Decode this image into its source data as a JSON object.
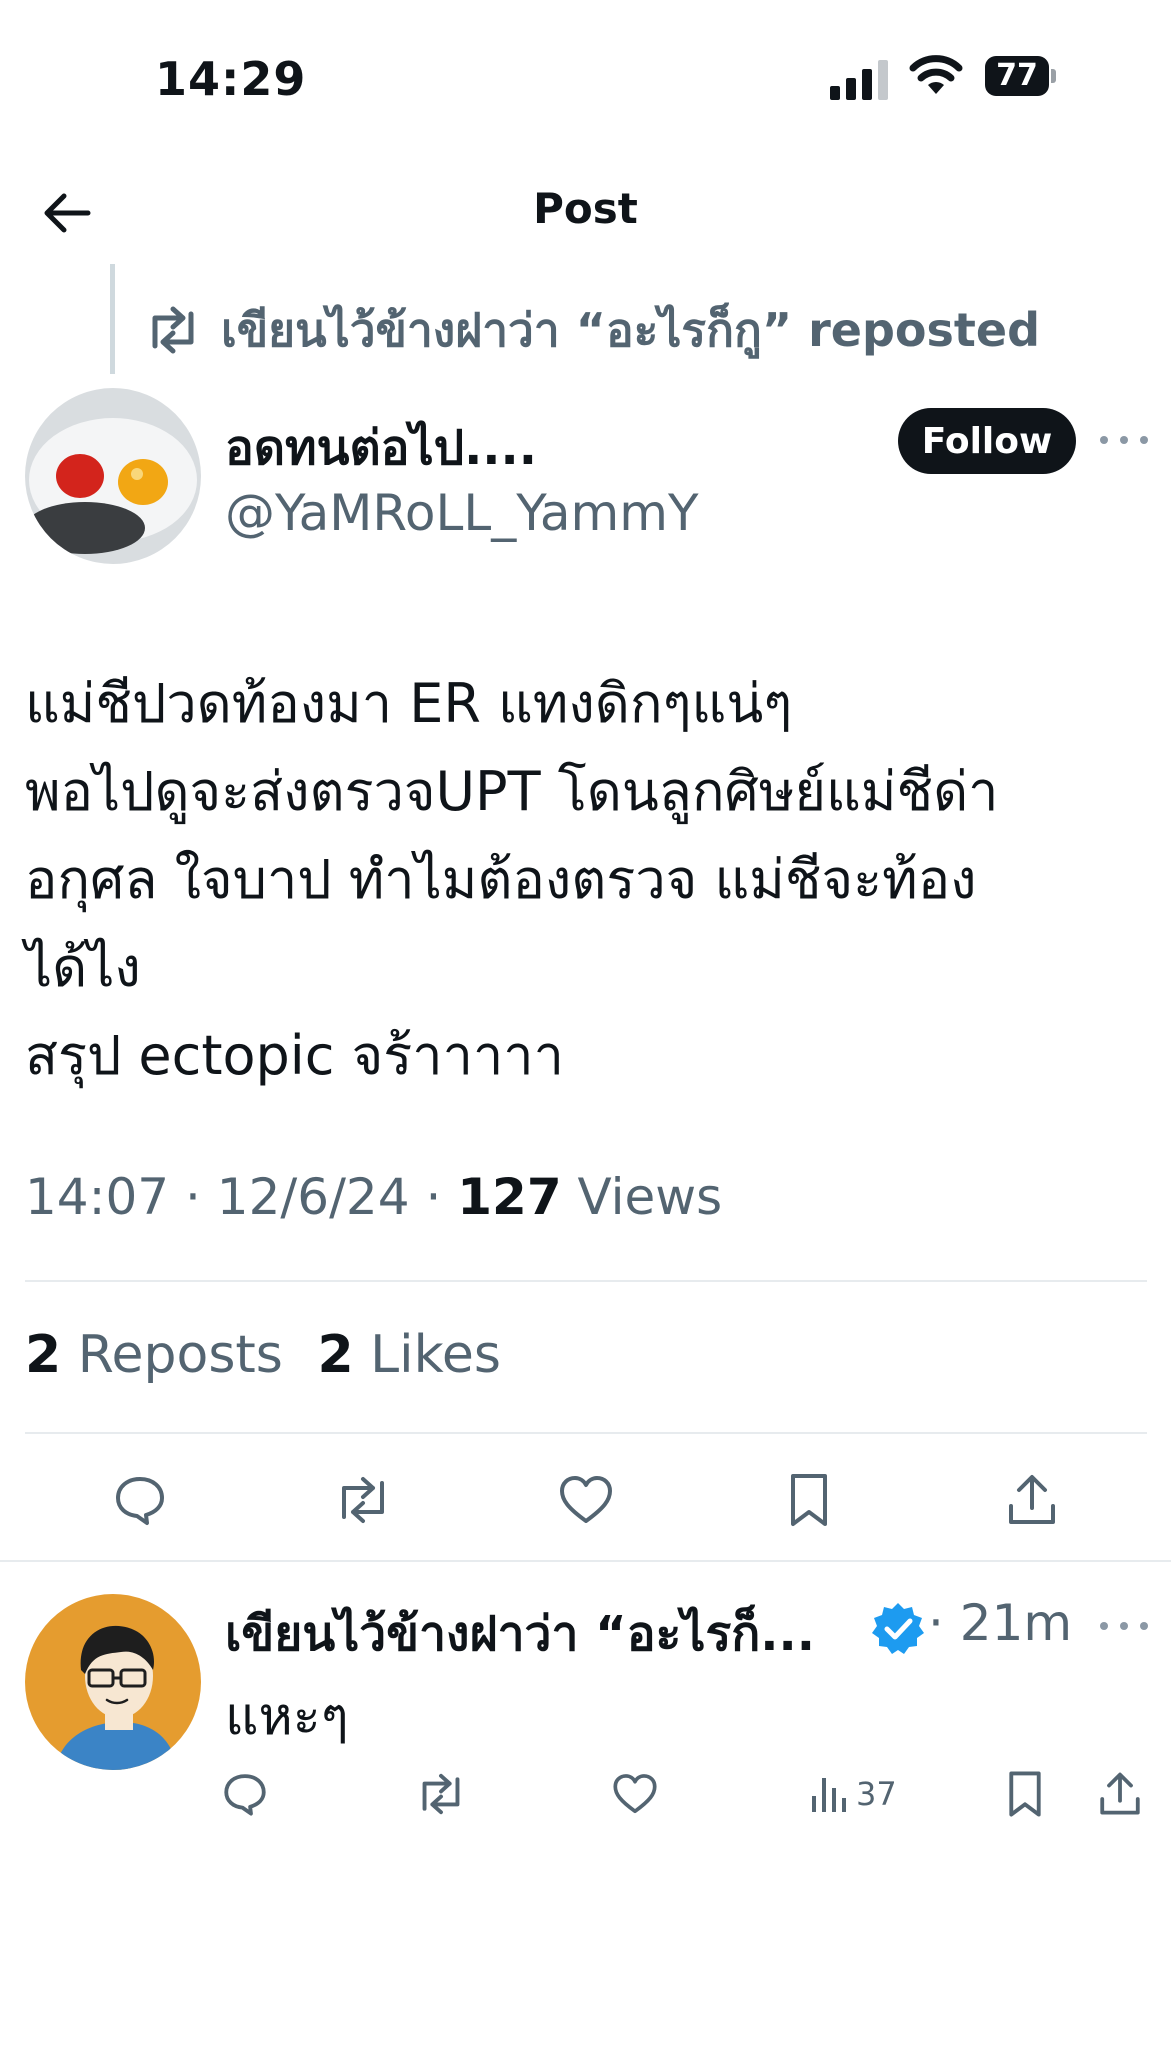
{
  "status_bar": {
    "time": "14:29",
    "battery": "77"
  },
  "header": {
    "title": "Post"
  },
  "repost": {
    "text": "เขียนไว้ข้างฝาว่า “อะไรก็กู” reposted"
  },
  "post": {
    "author_name": "อดทนต่อไป....",
    "author_handle": "@YaMRoLL_YammY",
    "follow_label": "Follow",
    "text_lines": [
      "แม่ชีปวดท้องมา ER แทงดิกๆแน่ๆ",
      "พอไปดูจะส่งตรวจUPT โดนลูกศิษย์แม่ชีด่า",
      "อกุศล ใจบาป ทำไมต้องตรวจ แม่ชีจะท้อง",
      "ได้ไง",
      "สรุป ectopic จร้าาาาา"
    ],
    "time": "14:07",
    "date": "12/6/24",
    "views_count": "127",
    "views_label": "Views",
    "reposts_count": "2",
    "reposts_label": "Reposts",
    "likes_count": "2",
    "likes_label": "Likes"
  },
  "reply": {
    "author_name": "เขียนไว้ข้างฝาว่า “อะไรก็...",
    "time": "21m",
    "text": "แหะๆ",
    "views": "37"
  },
  "colors": {
    "text": "#0f1419",
    "secondary": "#536471",
    "verified": "#1d9bf0",
    "divider": "#e7ebee"
  }
}
